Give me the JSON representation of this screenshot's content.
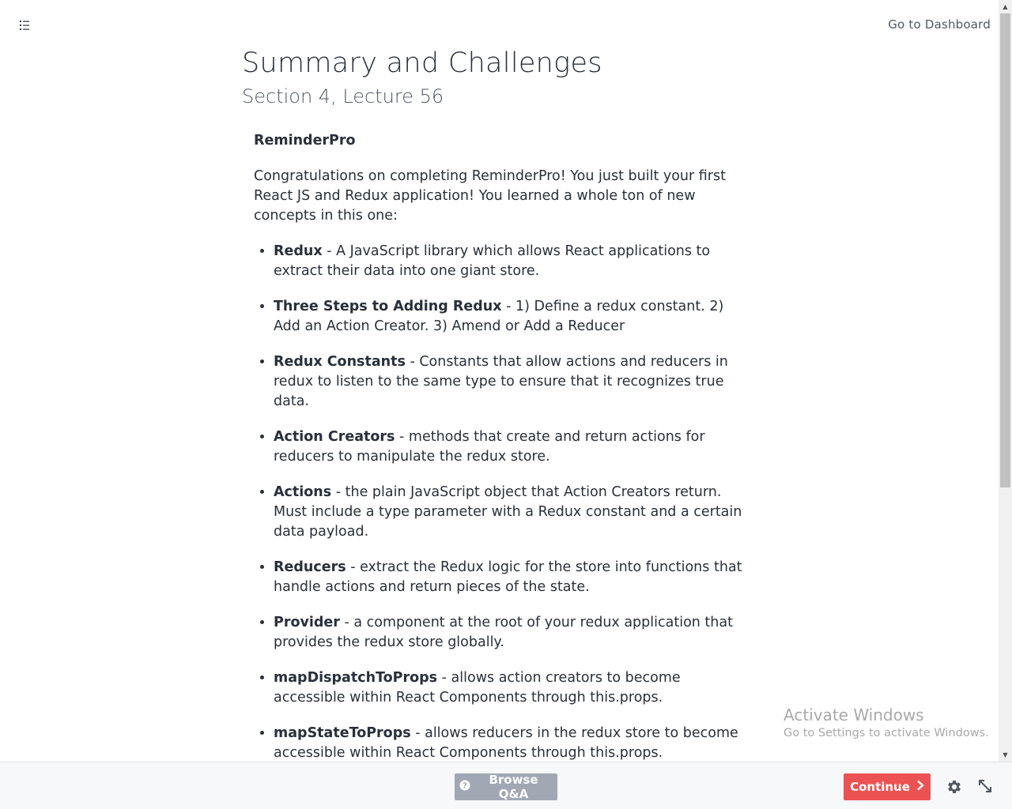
{
  "header": {
    "toc_icon": "list-icon",
    "dashboard_link": "Go to Dashboard"
  },
  "lecture": {
    "title": "Summary and Challenges",
    "subtitle": "Section 4, Lecture 56"
  },
  "article": {
    "heading": "ReminderPro",
    "intro": "Congratulations on completing ReminderPro! You just built your first React JS and Redux application! You learned a whole ton of new concepts in this one:",
    "items": [
      {
        "term": "Redux",
        "desc": " - A JavaScript library which allows React applications to extract their data into one giant store."
      },
      {
        "term": "Three Steps to Adding Redux",
        "desc": " -  1) Define a redux constant. 2) Add an Action Creator. 3) Amend or Add a Reducer"
      },
      {
        "term": "Redux Constants",
        "desc": " - Constants that allow actions and reducers in redux to listen to the same type to ensure that it recognizes true data."
      },
      {
        "term": "Action Creators",
        "desc": " - methods that create and return actions for reducers to manipulate the redux store."
      },
      {
        "term": "Actions",
        "desc": " - the plain JavaScript object that Action Creators return. Must include a type parameter with a Redux constant and a certain data payload."
      },
      {
        "term": "Reducers",
        "desc": " - extract the Redux logic for the store into functions that handle actions and return pieces of the state."
      },
      {
        "term": "Provider",
        "desc": " - a component at the root of your redux application that provides the redux store globally."
      },
      {
        "term": "mapDispatchToProps",
        "desc": " - allows action creators to become accessible within React Components through this.props."
      },
      {
        "term": "mapStateToProps",
        "desc": " - allows reducers in the redux store to become accessible within React Components through this.props."
      }
    ]
  },
  "watermark": {
    "title": "Activate Windows",
    "subtitle": "Go to Settings to activate Windows."
  },
  "footer": {
    "browse_qa_label": "Browse Q&A",
    "browse_qa_icon": "question-circle-icon",
    "continue_label": "Continue",
    "continue_icon": "chevron-right-icon",
    "settings_icon": "gear-icon",
    "expand_icon": "expand-icon",
    "colors": {
      "continue_bg": "#ec5252",
      "browse_bg": "#a1a7b3"
    }
  }
}
